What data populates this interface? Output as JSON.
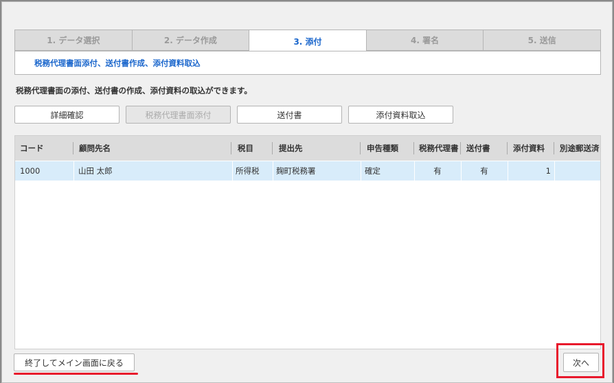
{
  "tabs": [
    {
      "label": "1. データ選択"
    },
    {
      "label": "2. データ作成"
    },
    {
      "label": "3. 添付"
    },
    {
      "label": "4. 署名"
    },
    {
      "label": "5. 送信"
    }
  ],
  "subpanel": {
    "title": "税務代理書面添付、送付書作成、添付資料取込"
  },
  "description": "税務代理書面の添付、送付書の作成、添付資料の取込ができます。",
  "toolbar": {
    "detail_label": "詳細確認",
    "tax_agent_attach_label": "税務代理書面添付",
    "cover_letter_label": "送付書",
    "attachment_import_label": "添付資料取込"
  },
  "table": {
    "columns": [
      "コード",
      "顧問先名",
      "税目",
      "提出先",
      "申告種類",
      "税務代理書",
      "送付書",
      "添付資料",
      "別途郵送済"
    ],
    "rows": [
      [
        "1000",
        "山田 太郎",
        "所得税",
        "麹町税務署",
        "確定",
        "有",
        "有",
        "1",
        ""
      ]
    ]
  },
  "footer": {
    "exit_label": "終了してメイン画面に戻る",
    "next_label": "次へ"
  },
  "colors": {
    "accent": "#1a66cc",
    "highlight": "#e8182c",
    "selected_row": "#d8ecfa"
  }
}
